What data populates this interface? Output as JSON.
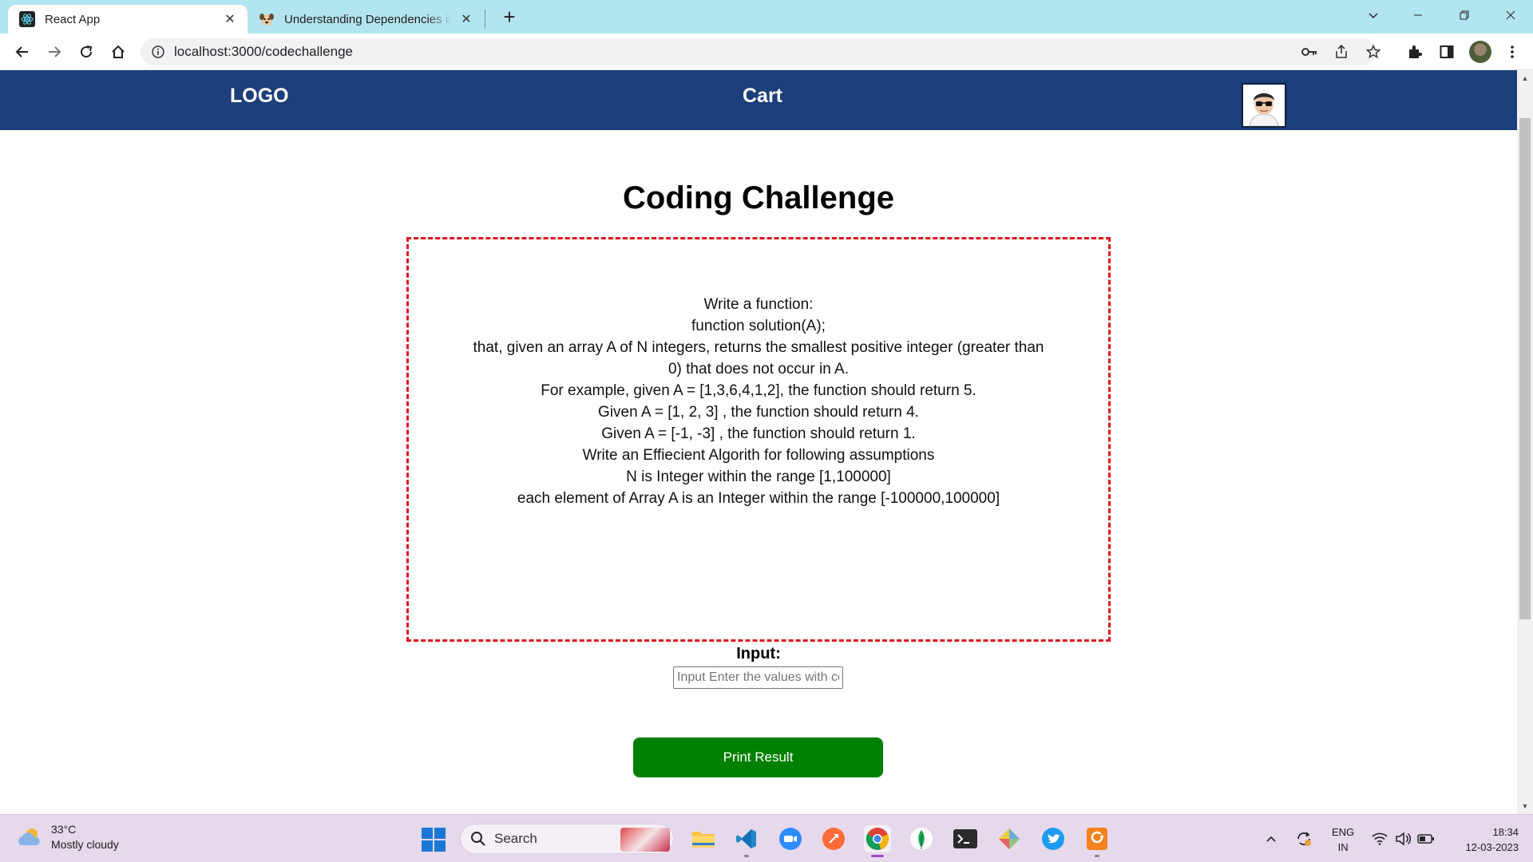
{
  "browser": {
    "tabs": [
      {
        "title": "React App",
        "active": true,
        "icon": "react-icon"
      },
      {
        "title": "Understanding Dependencies in React",
        "active": false,
        "icon": "dog-icon"
      }
    ],
    "new_tab": "+",
    "close_glyph": "✕",
    "url": "localhost:3000/codechallenge"
  },
  "navbar": {
    "logo": "LOGO",
    "cart": "Cart",
    "bg_color": "#1c3e7a"
  },
  "page": {
    "title": "Coding Challenge",
    "problem_lines": [
      "Write a function:",
      "function solution(A);",
      "that, given an array A of N integers, returns the smallest positive integer (greater than 0) that does not occur in A.",
      "For example, given A = [1,3,6,4,1,2], the function should return 5.",
      "Given A = [1, 2, 3] , the function should return 4.",
      "Given A = [-1, -3] , the function should return 1.",
      "Write an Effiecient Algorith for following assumptions",
      "N is Integer within the range [1,100000]",
      "each element of Array A is an Integer within the range [-100000,100000]"
    ],
    "input_label": "Input:",
    "input_value": "",
    "input_placeholder": "Input Enter the values with comma",
    "button_label": "Print Result",
    "button_color": "#008000",
    "border_color": "#e0141e"
  },
  "taskbar": {
    "weather_temp": "33°C",
    "weather_desc": "Mostly cloudy",
    "search_label": "Search",
    "lang_line1": "ENG",
    "lang_line2": "IN",
    "time": "18:34",
    "date": "12-03-2023"
  }
}
